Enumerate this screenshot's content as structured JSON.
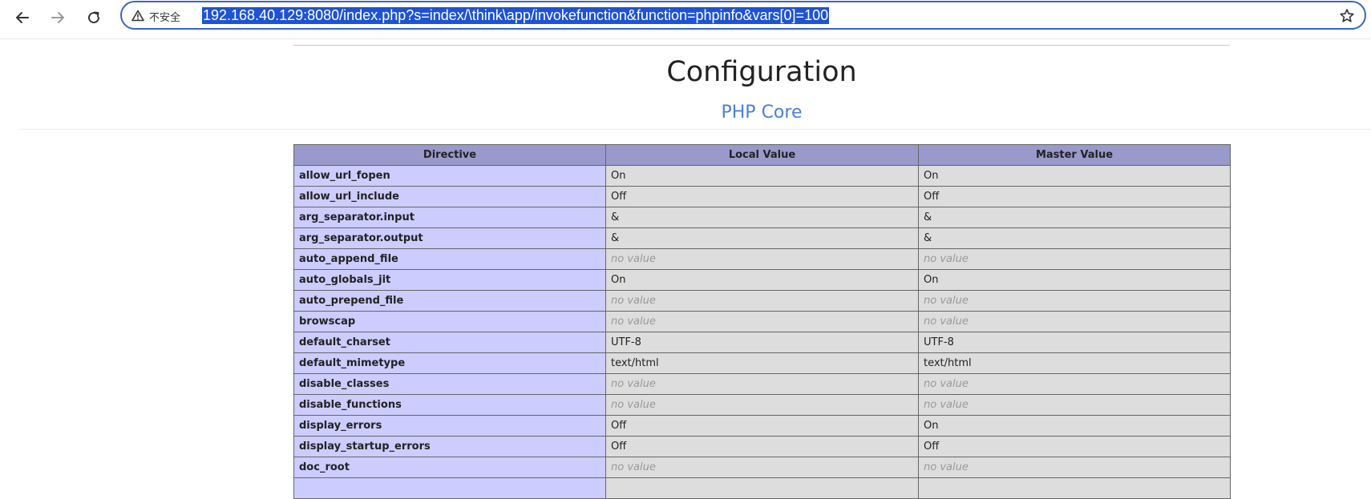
{
  "browser": {
    "security_label": "不安全",
    "url": "192.168.40.129:8080/index.php?s=index/\\think\\app/invokefunction&function=phpinfo&vars[0]=100",
    "icons": {
      "back": "back-arrow-icon",
      "forward": "forward-arrow-icon",
      "reload": "reload-icon",
      "warning": "warning-triangle-icon",
      "bookmark": "star-icon"
    },
    "colors": {
      "omnibox_border": "#3a63c6",
      "url_selection": "#1e53d6"
    }
  },
  "page": {
    "title": "Configuration",
    "section": "PHP Core",
    "colors": {
      "header_bg": "#9999cc",
      "directive_bg": "#ccccff",
      "value_bg": "#dddddd",
      "section_link": "#4a7fd8",
      "no_value": "#999999"
    }
  },
  "table": {
    "headers": [
      "Directive",
      "Local Value",
      "Master Value"
    ],
    "rows": [
      {
        "directive": "allow_url_fopen",
        "local": "On",
        "master": "On"
      },
      {
        "directive": "allow_url_include",
        "local": "Off",
        "master": "Off"
      },
      {
        "directive": "arg_separator.input",
        "local": "&",
        "master": "&"
      },
      {
        "directive": "arg_separator.output",
        "local": "&",
        "master": "&"
      },
      {
        "directive": "auto_append_file",
        "local": "no value",
        "master": "no value"
      },
      {
        "directive": "auto_globals_jit",
        "local": "On",
        "master": "On"
      },
      {
        "directive": "auto_prepend_file",
        "local": "no value",
        "master": "no value"
      },
      {
        "directive": "browscap",
        "local": "no value",
        "master": "no value"
      },
      {
        "directive": "default_charset",
        "local": "UTF-8",
        "master": "UTF-8"
      },
      {
        "directive": "default_mimetype",
        "local": "text/html",
        "master": "text/html"
      },
      {
        "directive": "disable_classes",
        "local": "no value",
        "master": "no value"
      },
      {
        "directive": "disable_functions",
        "local": "no value",
        "master": "no value"
      },
      {
        "directive": "display_errors",
        "local": "Off",
        "master": "On"
      },
      {
        "directive": "display_startup_errors",
        "local": "Off",
        "master": "Off"
      },
      {
        "directive": "doc_root",
        "local": "no value",
        "master": "no value"
      },
      {
        "directive": "",
        "local": "",
        "master": ""
      }
    ]
  }
}
